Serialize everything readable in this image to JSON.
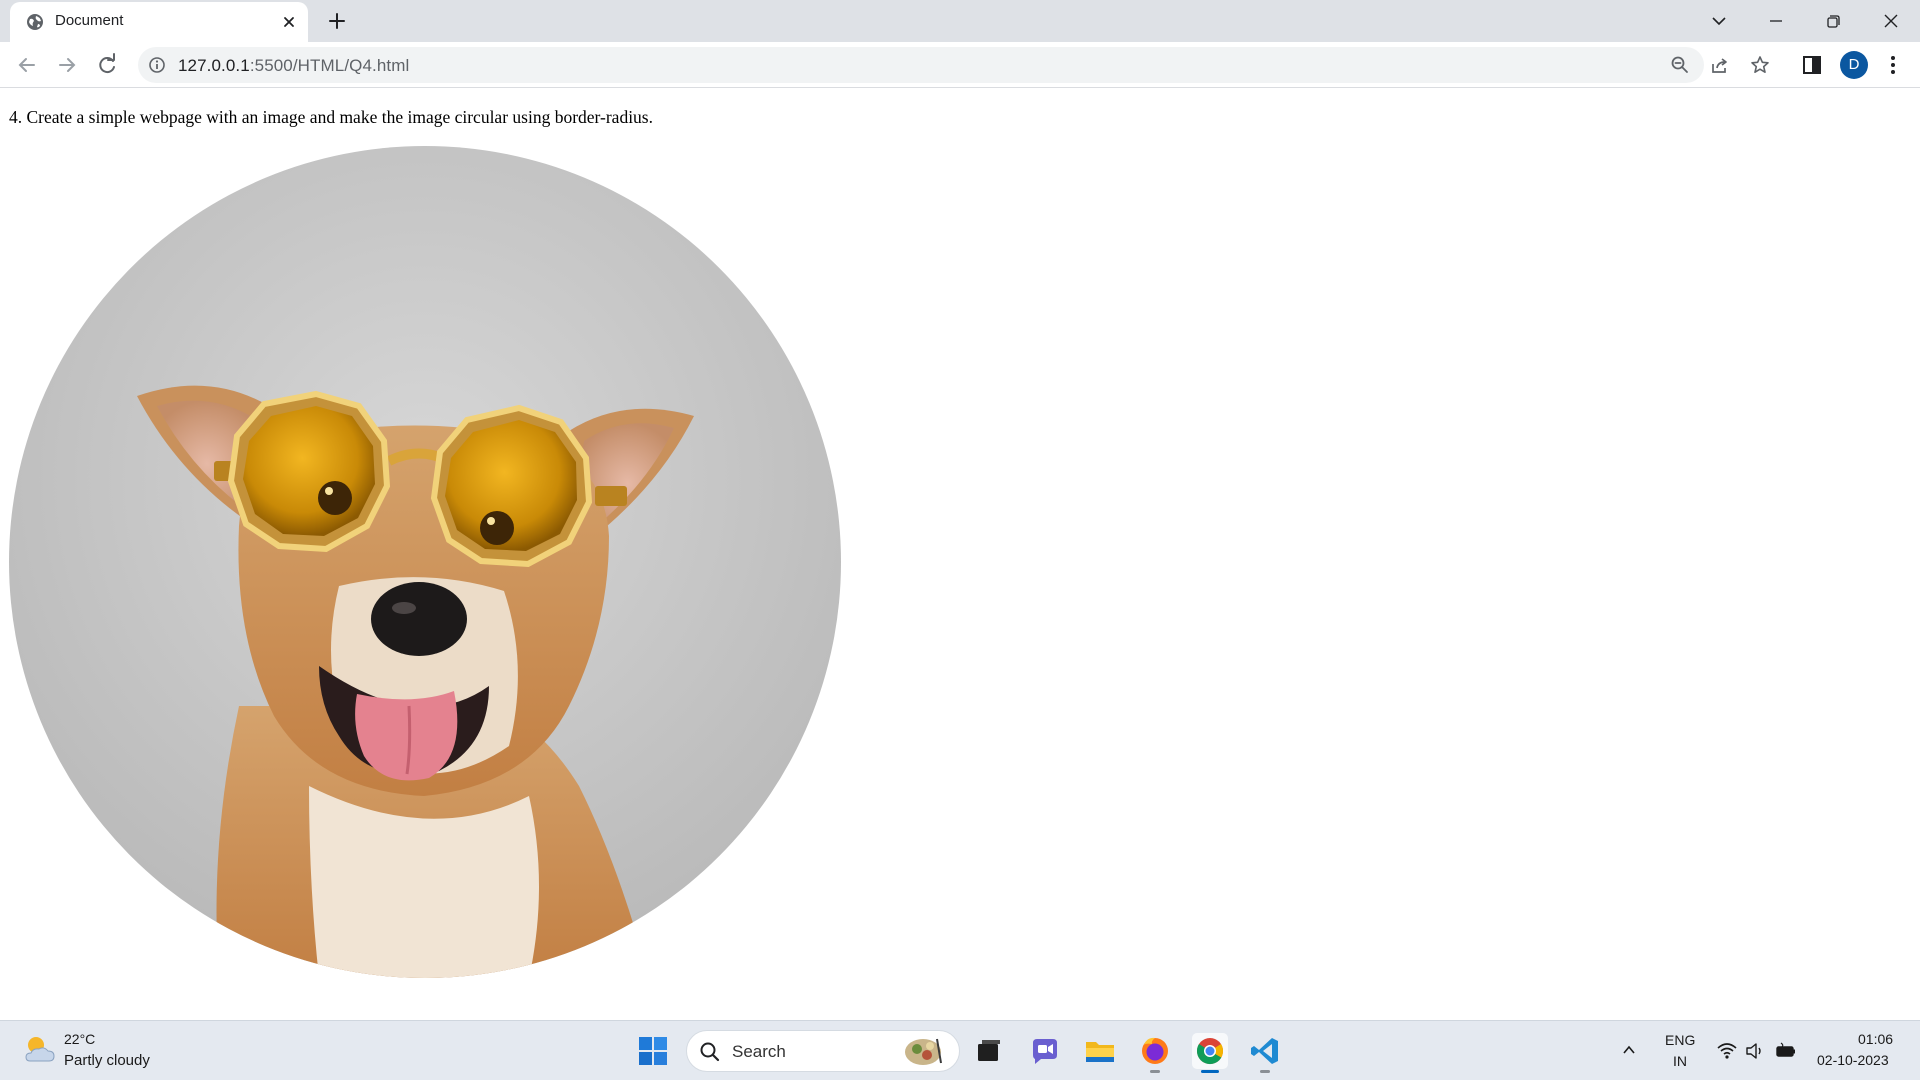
{
  "browser": {
    "tab": {
      "title": "Document",
      "favicon": "globe-icon"
    },
    "url": {
      "host": "127.0.0.1",
      "path": ":5500/HTML/Q4.html"
    },
    "profile_initial": "D"
  },
  "page": {
    "instruction": "4. Create a simple webpage with an image and make the image circular using border-radius.",
    "image": {
      "subject": "dog-wearing-yellow-sunglasses",
      "shape": "circle"
    }
  },
  "taskbar": {
    "weather": {
      "temp": "22°C",
      "desc": "Partly cloudy"
    },
    "search_label": "Search",
    "apps": [
      "task-view",
      "teams-chat",
      "file-explorer",
      "firefox",
      "chrome",
      "vscode"
    ],
    "tray": {
      "lang_top": "ENG",
      "lang_bottom": "IN"
    },
    "clock": {
      "time": "01:06",
      "date": "02-10-2023"
    }
  },
  "colors": {
    "tabstrip_bg": "#dee1e6",
    "omnibox_bg": "#f1f3f4",
    "avatar_bg": "#0b57a0",
    "taskbar_bg": "#e4e9f0",
    "accent": "#0067c0"
  }
}
